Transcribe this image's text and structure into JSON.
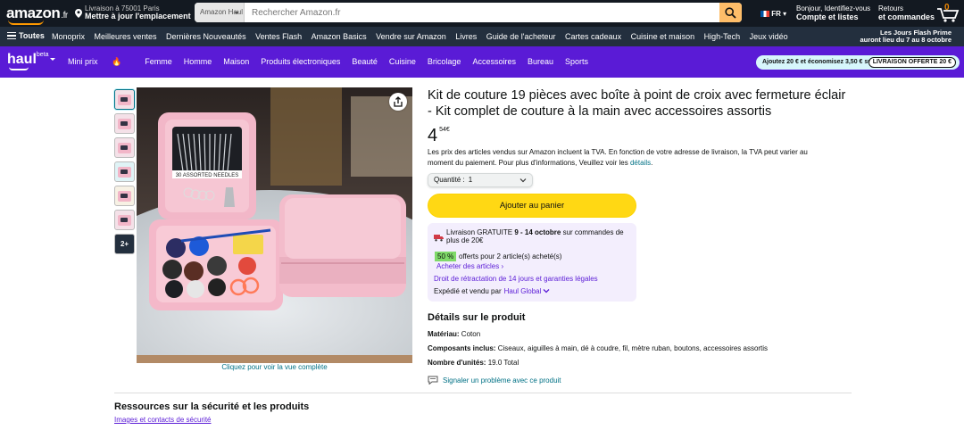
{
  "header": {
    "logo_text": "amazon",
    "logo_suffix": ".fr",
    "location_line1": "Livraison à 75001 Paris",
    "location_line2": "Mettre à jour l'emplacement",
    "search_category": "Amazon Haul",
    "search_placeholder": "Rechercher Amazon.fr",
    "language": "FR",
    "account_line1": "Bonjour, Identifiez-vous",
    "account_line2": "Compte et listes",
    "returns_line1": "Retours",
    "returns_line2": "et commandes",
    "cart_count": "0"
  },
  "nav": {
    "menu_label": "Toutes",
    "items": [
      "Monoprix",
      "Meilleures ventes",
      "Dernières Nouveautés",
      "Ventes Flash",
      "Amazon Basics",
      "Vendre sur Amazon",
      "Livres",
      "Guide de l'acheteur",
      "Cartes cadeaux",
      "Cuisine et maison",
      "High-Tech",
      "Jeux vidéo"
    ],
    "promo_line1": "Les Jours Flash Prime",
    "promo_line2": "auront lieu du 7 au 8 octobre"
  },
  "haul": {
    "logo_text": "haul",
    "logo_badge": "beta",
    "items": [
      "Mini prix",
      "Femme",
      "Homme",
      "Maison",
      "Produits électroniques",
      "Beauté",
      "Cuisine",
      "Bricolage",
      "Accessoires",
      "Bureau",
      "Sports"
    ],
    "mini_prix_emoji": "🔥",
    "promo_text": "Ajoutez 20 € et économisez 3,50 € sur l...",
    "promo_tag": "LIVRAISON OFFERTE 20 €",
    "colors": {
      "haul_bg": "#5a1bd6",
      "pill_bg": "#d7f6fb"
    }
  },
  "gallery": {
    "more_label": "2+",
    "caption": "Cliquez pour voir la vue complète"
  },
  "product": {
    "title": "Kit de couture 19 pièces avec boîte à point de croix avec fermeture éclair - Kit complet de couture à la main avec accessoires assortis",
    "price_whole": "4",
    "price_fraction": "54",
    "price_currency": "€",
    "tva_text": "Les prix des articles vendus sur Amazon incluent la TVA. En fonction de votre adresse de livraison, la TVA peut varier au moment du paiement. Pour plus d'informations, Veuillez voir les",
    "tva_link": "détails",
    "quantity_label": "Quantité :",
    "quantity_value": "1",
    "add_to_cart": "Ajouter au panier",
    "image_label": "30 ASSORTED NEEDLES"
  },
  "delivery": {
    "prefix": "Livraison GRATUITE",
    "dates": "9 - 14 octobre",
    "suffix": "sur commandes de plus de 20€",
    "badge": "50 %",
    "offer": "offerts pour 2 article(s) acheté(s)",
    "buy_link": "Acheter des articles ›",
    "returns_link": "Droit de rétractation de 14 jours et garanties légales",
    "sold_by_label": "Expédié et vendu par",
    "seller": "Haul Global"
  },
  "details": {
    "heading": "Détails sur le produit",
    "rows": [
      {
        "label": "Matériau:",
        "value": "Coton"
      },
      {
        "label": "Composants inclus:",
        "value": "Ciseaux, aiguilles à main, dé à coudre, fil, mètre ruban, boutons, accessoires assortis"
      },
      {
        "label": "Nombre d'unités:",
        "value": "19.0 Total"
      }
    ],
    "report_link": "Signaler un problème avec ce produit"
  },
  "safety": {
    "heading": "Ressources sur la sécurité et les produits",
    "link": "Images et contacts de sécurité"
  },
  "colors": {
    "header_bg": "#131921",
    "nav_bg": "#232f3e",
    "cart_button": "#ffd814",
    "link_teal": "#007185",
    "link_purple": "#5a1bd6",
    "delivery_box": "#f3eefd"
  }
}
